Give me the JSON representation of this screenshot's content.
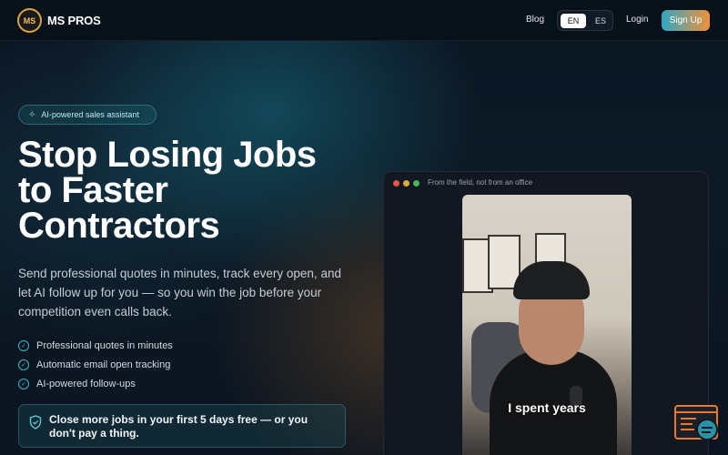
{
  "brand": {
    "name": "MS PROS",
    "logo_mark": "MS"
  },
  "nav": {
    "blog": "Blog",
    "languages": [
      "EN",
      "ES"
    ],
    "active_language": "EN",
    "login": "Login",
    "signup": "Sign Up"
  },
  "hero": {
    "badge": "AI-powered sales assistant",
    "headline": [
      "Stop Losing Jobs",
      "to Faster",
      "Contractors"
    ],
    "subheadline": "Send professional quotes in minutes, track every open, and let AI follow up for you — so you win the job before your competition even calls back.",
    "features": [
      "Professional quotes in minutes",
      "Automatic email open tracking",
      "AI-powered follow-ups"
    ],
    "guarantee": "Close more jobs in your first 5 days free — or you don't pay a thing."
  },
  "video_card": {
    "caption": "From the field, not from an office",
    "subtitle": "I spent years"
  },
  "icons": {
    "badge": "sparkle-icon",
    "feature": "check-circle-icon",
    "guarantee": "shield-check-icon",
    "chat": "chat-widget-icon"
  },
  "colors": {
    "accent_teal": "#39b9c9",
    "accent_orange": "#f0913a",
    "background": "#0b1320"
  }
}
